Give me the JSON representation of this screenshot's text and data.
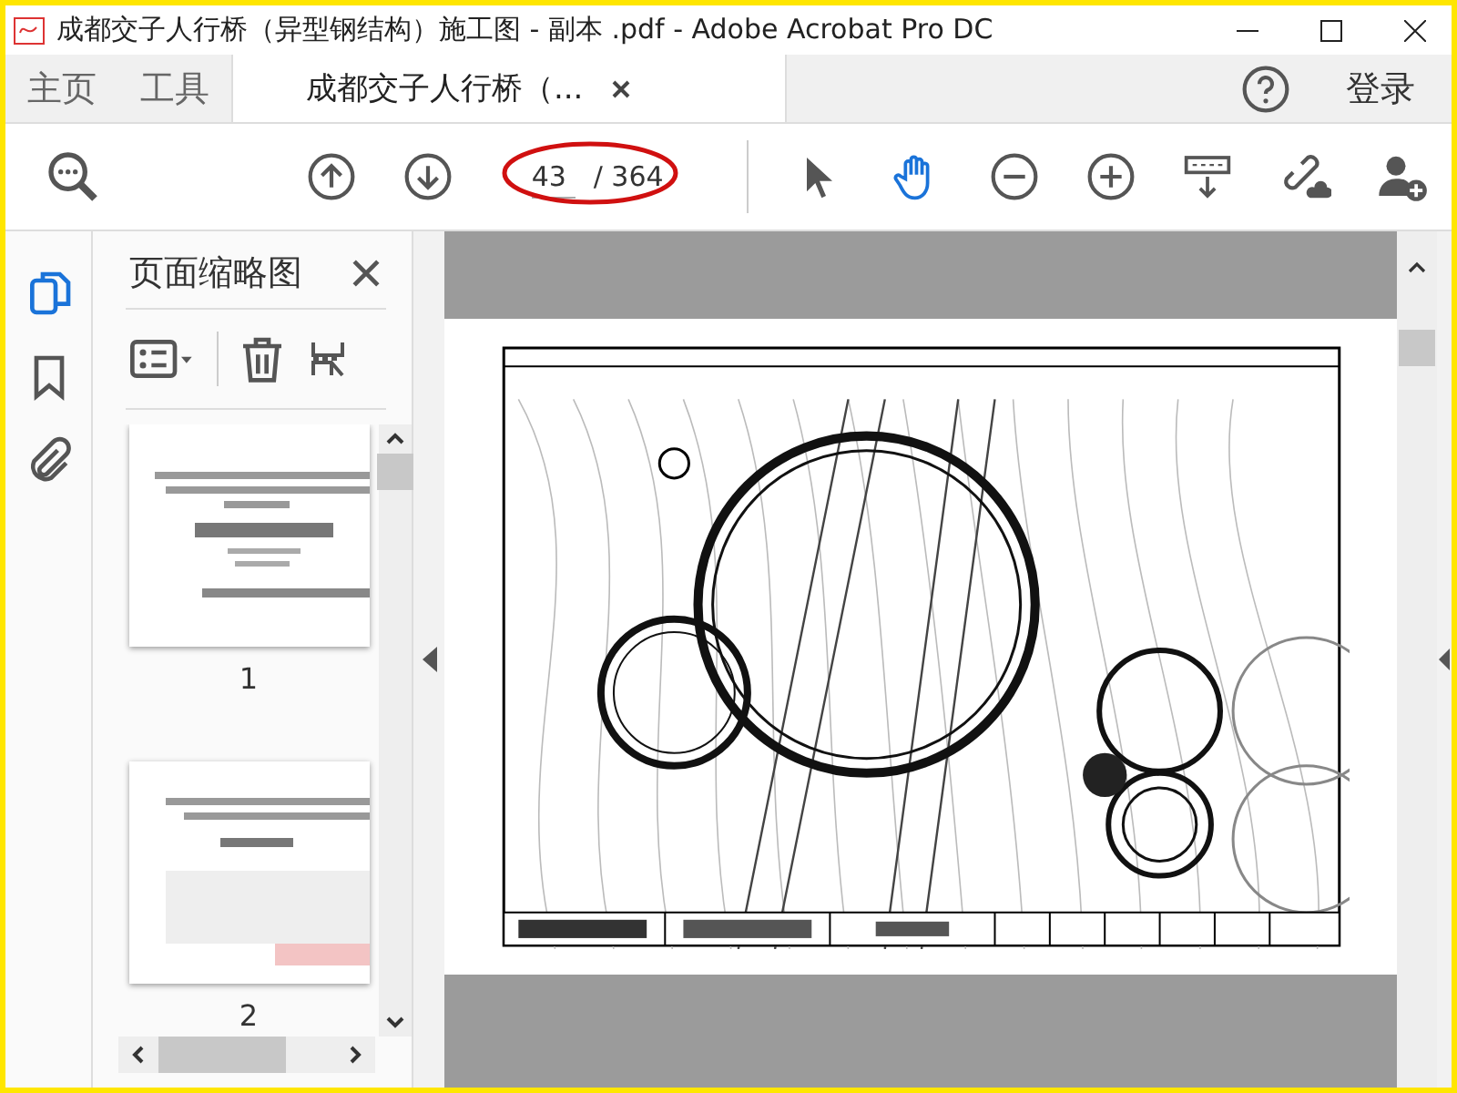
{
  "window": {
    "title": "成都交子人行桥（异型钢结构）施工图 - 副本 .pdf - Adobe Acrobat Pro DC"
  },
  "tabs": [
    {
      "label": "主页",
      "selected": false
    },
    {
      "label": "工具",
      "selected": false
    },
    {
      "label": "成都交子人行桥（...",
      "selected": true,
      "kind": "document"
    }
  ],
  "header_right": {
    "signin": "登录"
  },
  "toolbar": {
    "current_page": "43",
    "page_total": "/ 364",
    "hand_tool_active": true
  },
  "thumbnails_panel": {
    "title": "页面缩略图",
    "pages": [
      {
        "label": "1",
        "selected": false
      },
      {
        "label": "2",
        "selected": false
      }
    ]
  }
}
